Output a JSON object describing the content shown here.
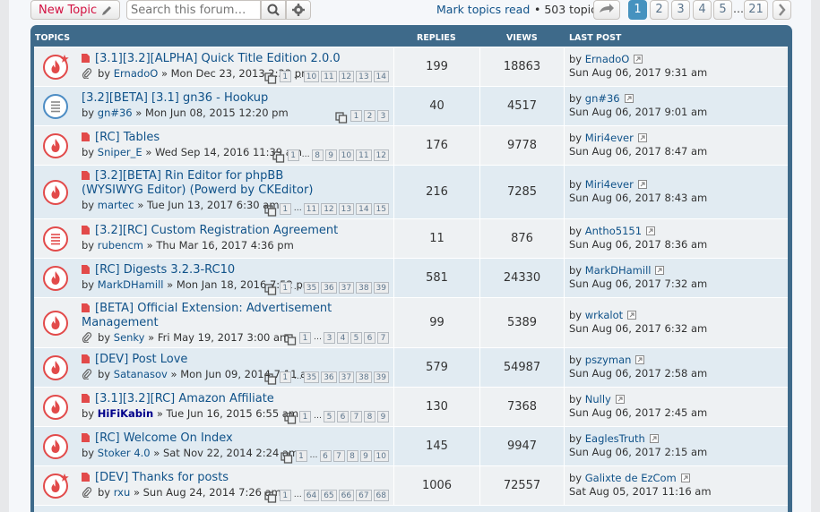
{
  "actions": {
    "new_topic_label": "New Topic",
    "search_placeholder": "Search this forum…",
    "mark_read": "Mark topics read",
    "topic_count": "• 503 topics",
    "pages": [
      "1",
      "2",
      "3",
      "4",
      "5"
    ],
    "ellipsis": "…",
    "last_page": "21",
    "current_page": "1"
  },
  "header": {
    "topics": "TOPICS",
    "replies": "REPLIES",
    "views": "VIEWS",
    "last_post": "LAST POST"
  },
  "colors": {
    "hot_red": "#e24a4a",
    "link_blue": "#105289",
    "panel_blue": "#3e6a8a",
    "active_page": "#4692bf"
  },
  "topics": [
    {
      "title": "[3.1][3.2][ALPHA] Quick Title Edition 2.0.0",
      "by": "by",
      "author": "ErnadoO",
      "date": "» Mon Dec 23, 2013 2:33 pm",
      "pages": [
        "1",
        "…",
        "10",
        "11",
        "12",
        "13",
        "14"
      ],
      "replies": "199",
      "views": "18863",
      "lp_by": "by",
      "lp_user": "ErnadoO",
      "lp_date": "Sun Aug 06, 2017 9:31 am",
      "icon": "hot-star-icon",
      "attach": true
    },
    {
      "title": "[3.2][BETA] [3.1] gn36 - Hookup",
      "by": "by",
      "author": "gn#36",
      "date": "» Mon Jun 08, 2015 12:20 pm",
      "pages": [
        "1",
        "2",
        "3"
      ],
      "replies": "40",
      "views": "4517",
      "lp_by": "by",
      "lp_user": "gn#36",
      "lp_date": "Sun Aug 06, 2017 9:01 am",
      "icon": "normal-topic-icon",
      "attach": false
    },
    {
      "title": "[RC] Tables",
      "by": "by",
      "author": "Sniper_E",
      "date": "» Wed Sep 14, 2016 11:39 am",
      "pages": [
        "1",
        "…",
        "8",
        "9",
        "10",
        "11",
        "12"
      ],
      "replies": "176",
      "views": "9778",
      "lp_by": "by",
      "lp_user": "Miri4ever",
      "lp_date": "Sun Aug 06, 2017 8:47 am",
      "icon": "hot-topic-icon",
      "attach": false
    },
    {
      "title": "[3.2][BETA] Rin Editor for phpBB (WYSIWYG Editor) (Powerd by CKEditor)",
      "by": "by",
      "author": "martec",
      "date": "» Tue Jun 13, 2017 6:30 am",
      "pages": [
        "1",
        "…",
        "11",
        "12",
        "13",
        "14",
        "15"
      ],
      "replies": "216",
      "views": "7285",
      "lp_by": "by",
      "lp_user": "Miri4ever",
      "lp_date": "Sun Aug 06, 2017 8:43 am",
      "icon": "hot-topic-icon",
      "attach": false
    },
    {
      "title": "[3.2][RC] Custom Registration Agreement",
      "by": "by",
      "author": "rubencm",
      "date": "» Thu Mar 16, 2017 4:36 pm",
      "pages": [],
      "replies": "11",
      "views": "876",
      "lp_by": "by",
      "lp_user": "Antho5151",
      "lp_date": "Sun Aug 06, 2017 8:36 am",
      "icon": "read-topic-icon",
      "attach": false
    },
    {
      "title": "[RC] Digests 3.2.3-RC10",
      "by": "by",
      "author": "MarkDHamill",
      "date": "» Mon Jan 18, 2016 7:52 pm",
      "pages": [
        "1",
        "…",
        "35",
        "36",
        "37",
        "38",
        "39"
      ],
      "replies": "581",
      "views": "24330",
      "lp_by": "by",
      "lp_user": "MarkDHamill",
      "lp_date": "Sun Aug 06, 2017 7:32 am",
      "icon": "hot-topic-icon",
      "attach": false
    },
    {
      "title": "[BETA] Official Extension: Advertisement Management",
      "by": "by",
      "author": "Senky",
      "date": "» Fri May 19, 2017 3:00 am",
      "pages": [
        "1",
        "…",
        "3",
        "4",
        "5",
        "6",
        "7"
      ],
      "replies": "99",
      "views": "5389",
      "lp_by": "by",
      "lp_user": "wrkalot",
      "lp_date": "Sun Aug 06, 2017 6:32 am",
      "icon": "hot-topic-icon",
      "attach": true
    },
    {
      "title": "[DEV] Post Love",
      "by": "by",
      "author": "Satanasov",
      "date": "» Mon Jun 09, 2014 7:11 am",
      "pages": [
        "1",
        "…",
        "35",
        "36",
        "37",
        "38",
        "39"
      ],
      "replies": "579",
      "views": "54987",
      "lp_by": "by",
      "lp_user": "pszyman",
      "lp_date": "Sun Aug 06, 2017 2:58 am",
      "icon": "hot-topic-icon",
      "attach": true
    },
    {
      "title": "[3.1][3.2][RC] Amazon Affiliate",
      "by": "by",
      "author": "HiFiKabin",
      "date": "» Tue Jun 16, 2015 6:55 am",
      "pages": [
        "1",
        "…",
        "5",
        "6",
        "7",
        "8",
        "9"
      ],
      "replies": "130",
      "views": "7368",
      "lp_by": "by",
      "lp_user": "Nully",
      "lp_date": "Sun Aug 06, 2017 2:45 am",
      "icon": "hot-topic-icon",
      "attach": false
    },
    {
      "title": "[RC] Welcome On Index",
      "by": "by",
      "author": "Stoker 4.0",
      "date": "» Sat Nov 22, 2014 2:24 am",
      "pages": [
        "1",
        "…",
        "6",
        "7",
        "8",
        "9",
        "10"
      ],
      "replies": "145",
      "views": "9947",
      "lp_by": "by",
      "lp_user": "EaglesTruth",
      "lp_date": "Sun Aug 06, 2017 2:15 am",
      "icon": "hot-topic-icon",
      "attach": false
    },
    {
      "title": "[DEV] Thanks for posts",
      "by": "by",
      "author": "rxu",
      "date": "» Sun Aug 24, 2014 7:26 am",
      "pages": [
        "1",
        "…",
        "64",
        "65",
        "66",
        "67",
        "68"
      ],
      "replies": "1006",
      "views": "72557",
      "lp_by": "by",
      "lp_user": "Galixte de EzCom",
      "lp_date": "Sat Aug 05, 2017 11:16 am",
      "icon": "hot-star-icon",
      "attach": true
    }
  ]
}
